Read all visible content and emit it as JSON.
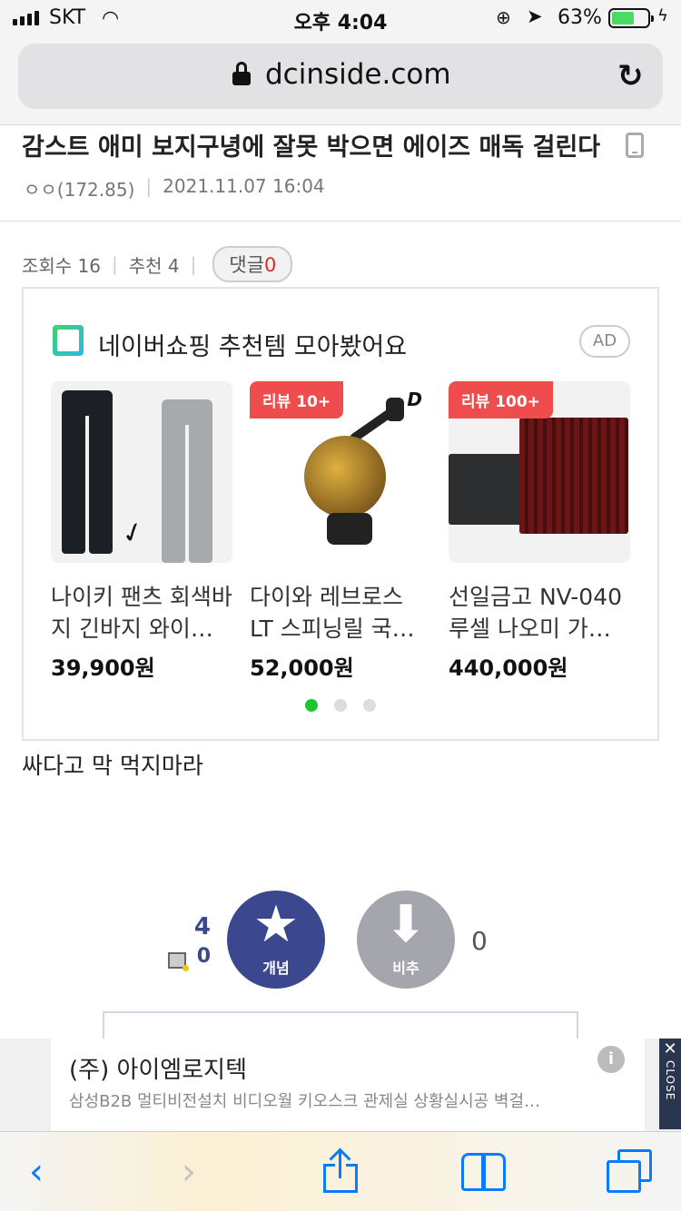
{
  "status_bar": {
    "carrier": "SKT",
    "time": "오후 4:04",
    "battery_percent": "63%",
    "battery_level": 0.63
  },
  "browser": {
    "domain": "dcinside.com"
  },
  "post": {
    "title": "감스트 애미 보지구녕에 잘못 박으면 에이즈 매독 걸린다",
    "author": "ㅇㅇ(172.85)",
    "date": "2021.11.07 16:04",
    "views_label": "조회수 16",
    "recommend_label": "추천 4",
    "comments_label": "댓글",
    "comments_count": "0",
    "body": "싸다고 막 먹지마라"
  },
  "ad": {
    "heading": "네이버쇼핑 추천템 모아봤어요",
    "badge": "AD",
    "products": [
      {
        "name": "나이키 팬츠 회색바지 긴바지 와이…",
        "price": "39,900원",
        "tag": ""
      },
      {
        "name": "다이와 레브로스 LT 스피닝릴 국…",
        "price": "52,000원",
        "tag": "리뷰 10+"
      },
      {
        "name": "선일금고 NV-040 루셀 나오미 가…",
        "price": "440,000원",
        "tag": "리뷰 100+"
      }
    ],
    "page_dots": 3,
    "active_dot": 0
  },
  "votes": {
    "up_count": "4",
    "fix_count": "0",
    "up_label": "개념",
    "down_label": "비추",
    "down_count": "0"
  },
  "banner": {
    "company": "(주) 아이엠로지텍",
    "description": "삼성B2B 멀티비전설치 비디오월 키오스크 관제실 상황실시공 벽걸…",
    "close_label": "CLOSE"
  },
  "colors": {
    "accent": "#3b4890",
    "ios_blue": "#0a7aff",
    "tag_red": "#ef4d4d",
    "dot_active": "#1ec62e"
  }
}
